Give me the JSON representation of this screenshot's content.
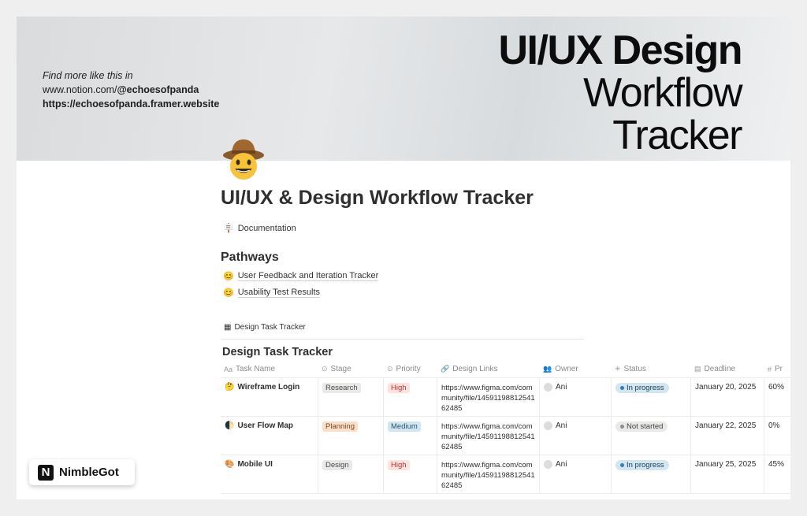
{
  "cover": {
    "promo_line1": "Find more like this in",
    "promo_line2_prefix": "www.notion.com/",
    "promo_line2_handle": "@echoesofpanda",
    "promo_line3": "https://echoesofpanda.framer.website",
    "title_line1": "UI/UX Design",
    "title_line2": "Workflow",
    "title_line3": "Tracker"
  },
  "page": {
    "icon": "cowboy-smiley-icon",
    "title": "UI/UX & Design Workflow Tracker",
    "documentation_label": "Documentation",
    "pathways_heading": "Pathways",
    "pathways": [
      {
        "label": "User Feedback and Iteration Tracker"
      },
      {
        "label": "Usability Test Results"
      }
    ]
  },
  "database": {
    "view_tab_label": "Design Task Tracker",
    "title": "Design Task Tracker",
    "columns": [
      "Task Name",
      "Stage",
      "Priority",
      "Design Links",
      "Owner",
      "Status",
      "Deadline",
      "Pr"
    ],
    "rows": [
      {
        "task": "Wireframe Login",
        "task_emoji": "🤔",
        "stage": "Research",
        "priority": "High",
        "link": "https://www.figma.com/community/file/1459119881254162485",
        "owner": "Ani",
        "status": "In progress",
        "deadline": "January 20, 2025",
        "progress": "60%"
      },
      {
        "task": "User Flow Map",
        "task_emoji": "🌓",
        "stage": "Planning",
        "priority": "Medium",
        "link": "https://www.figma.com/community/file/1459119881254162485",
        "owner": "Ani",
        "status": "Not started",
        "deadline": "January 22, 2025",
        "progress": "0%"
      },
      {
        "task": "Mobile UI",
        "task_emoji": "🎨",
        "stage": "Design",
        "priority": "High",
        "link": "https://www.figma.com/community/file/1459119881254162485",
        "owner": "Ani",
        "status": "In progress",
        "deadline": "January 25, 2025",
        "progress": "45%"
      }
    ]
  },
  "branding": {
    "name": "NimbleGot",
    "logo_letter": "N"
  },
  "colors": {
    "tag_red": "#ffe2dd",
    "tag_blue": "#d3e5ef",
    "tag_gray": "#e9e9e7",
    "tag_orange": "#fadec9"
  }
}
